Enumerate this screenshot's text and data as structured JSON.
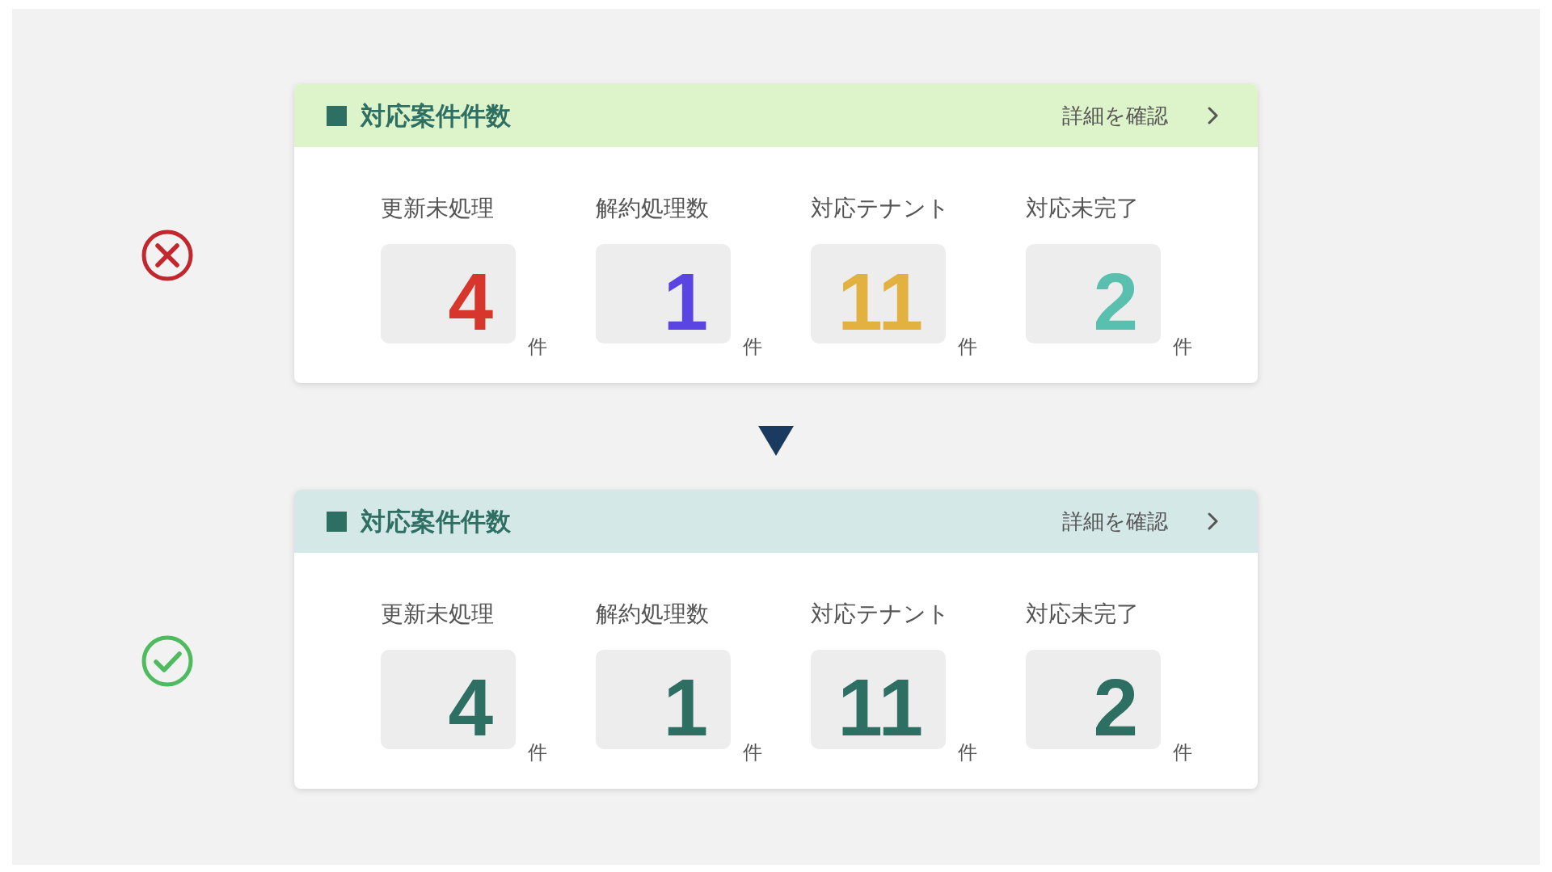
{
  "cards": [
    {
      "kind": "bad",
      "color": "#ddf3c9",
      "title": "対応案件件数",
      "link": "詳細を確認",
      "metrics": [
        {
          "label": "更新未処理",
          "value": "4",
          "unit": "件",
          "color": "#d6362b"
        },
        {
          "label": "解約処理数",
          "value": "1",
          "unit": "件",
          "color": "#5a44e2"
        },
        {
          "label": "対応テナント",
          "value": "11",
          "unit": "件",
          "color": "#e2b13f"
        },
        {
          "label": "対応未完了",
          "value": "2",
          "unit": "件",
          "color": "#59bfae"
        }
      ]
    },
    {
      "kind": "good",
      "color": "#d4e9e7",
      "title": "対応案件件数",
      "link": "詳細を確認",
      "metrics": [
        {
          "label": "更新未処理",
          "value": "4",
          "unit": "件",
          "color": "#2e6f64"
        },
        {
          "label": "解約処理数",
          "value": "1",
          "unit": "件",
          "color": "#2e6f64"
        },
        {
          "label": "対応テナント",
          "value": "11",
          "unit": "件",
          "color": "#2e6f64"
        },
        {
          "label": "対応未完了",
          "value": "2",
          "unit": "件",
          "color": "#2e6f64"
        }
      ]
    }
  ]
}
